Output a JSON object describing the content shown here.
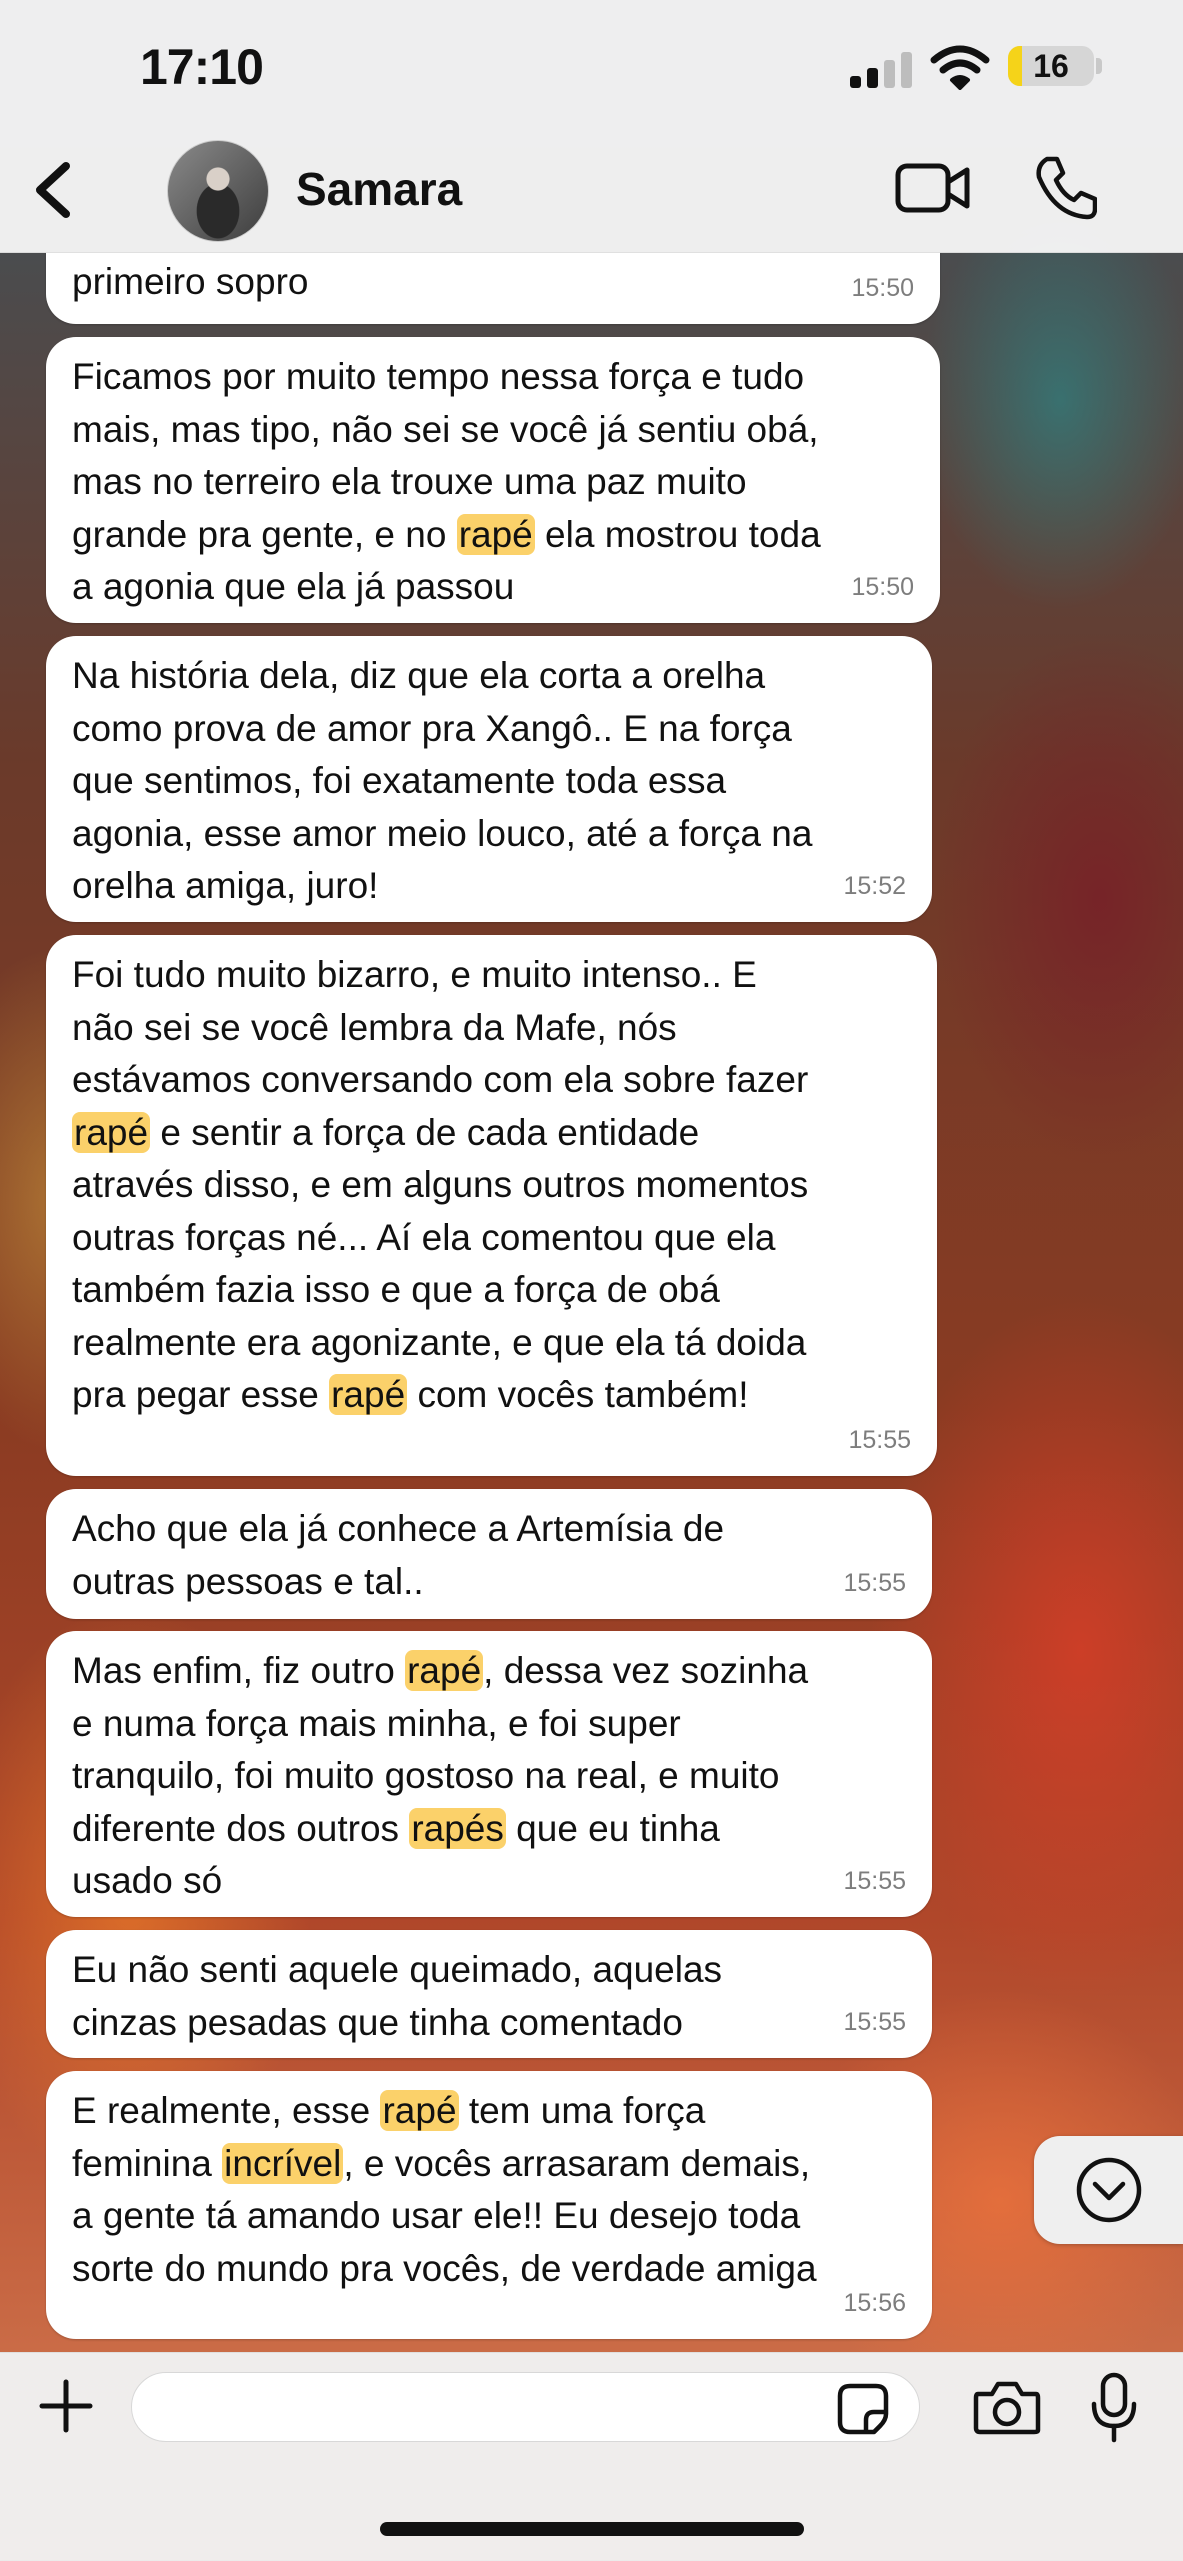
{
  "status_bar": {
    "time": "17:10",
    "battery": "16",
    "battery_level": 0.16
  },
  "header": {
    "contact_name": "Samara"
  },
  "colors": {
    "highlight": "#fbd16a",
    "bubble": "#ffffff",
    "bar": "#f4f4f4"
  },
  "messages": [
    {
      "text": "primeiro sopro",
      "time": "15:50"
    },
    {
      "parts": [
        "Ficamos por muito tempo nessa força e tudo\nmais, mas tipo, não sei se você já sentiu obá,\nmas no terreiro ela trouxe uma paz muito\ngrande pra gente, e no ",
        "rapé",
        " ela mostrou toda\na agonia que ela já passou"
      ],
      "time": "15:50"
    },
    {
      "text": "Na história dela, diz que ela corta a orelha\ncomo prova de amor pra Xangô.. E na força\nque sentimos, foi exatamente toda essa\nagonia, esse amor meio louco, até a força na\norelha amiga, juro!",
      "time": "15:52"
    },
    {
      "parts": [
        "Foi tudo muito bizarro, e muito intenso.. E\nnão sei se você lembra da Mafe, nós\nestávamos conversando com ela sobre fazer\n",
        "rapé",
        " e sentir a força de cada entidade\natravés disso, e em alguns outros momentos\noutras forças né... Aí ela comentou que ela\ntambém fazia isso e que a força de obá\nrealmente era agonizante, e que ela tá doida\npra pegar esse ",
        "rapé",
        " com vocês também!"
      ],
      "time": "15:55"
    },
    {
      "text": "Acho que ela já conhece a Artemísia de\noutras pessoas e tal..",
      "time": "15:55"
    },
    {
      "parts": [
        "Mas enfim, fiz outro ",
        "rapé",
        ", dessa vez sozinha\ne numa força mais minha, e foi super\ntranquilo, foi muito gostoso na real, e muito\ndiferente dos outros ",
        "rapés",
        " que eu tinha\nusado só"
      ],
      "time": "15:55"
    },
    {
      "text": "Eu não senti aquele queimado, aquelas\ncinzas pesadas que tinha comentado",
      "time": "15:55"
    },
    {
      "parts": [
        "E realmente, esse ",
        "rapé",
        " tem uma força\nfeminina ",
        "incrível",
        ", e vocês arrasaram demais,\na gente tá amando usar ele!! Eu desejo toda\nsorte do mundo pra vocês, de verdade amiga"
      ],
      "time": "15:56"
    }
  ],
  "icons": [
    "back-chevron-icon",
    "video-camera-icon",
    "phone-icon",
    "chevron-down-icon",
    "plus-icon",
    "sticker-icon",
    "camera-icon",
    "microphone-icon"
  ]
}
